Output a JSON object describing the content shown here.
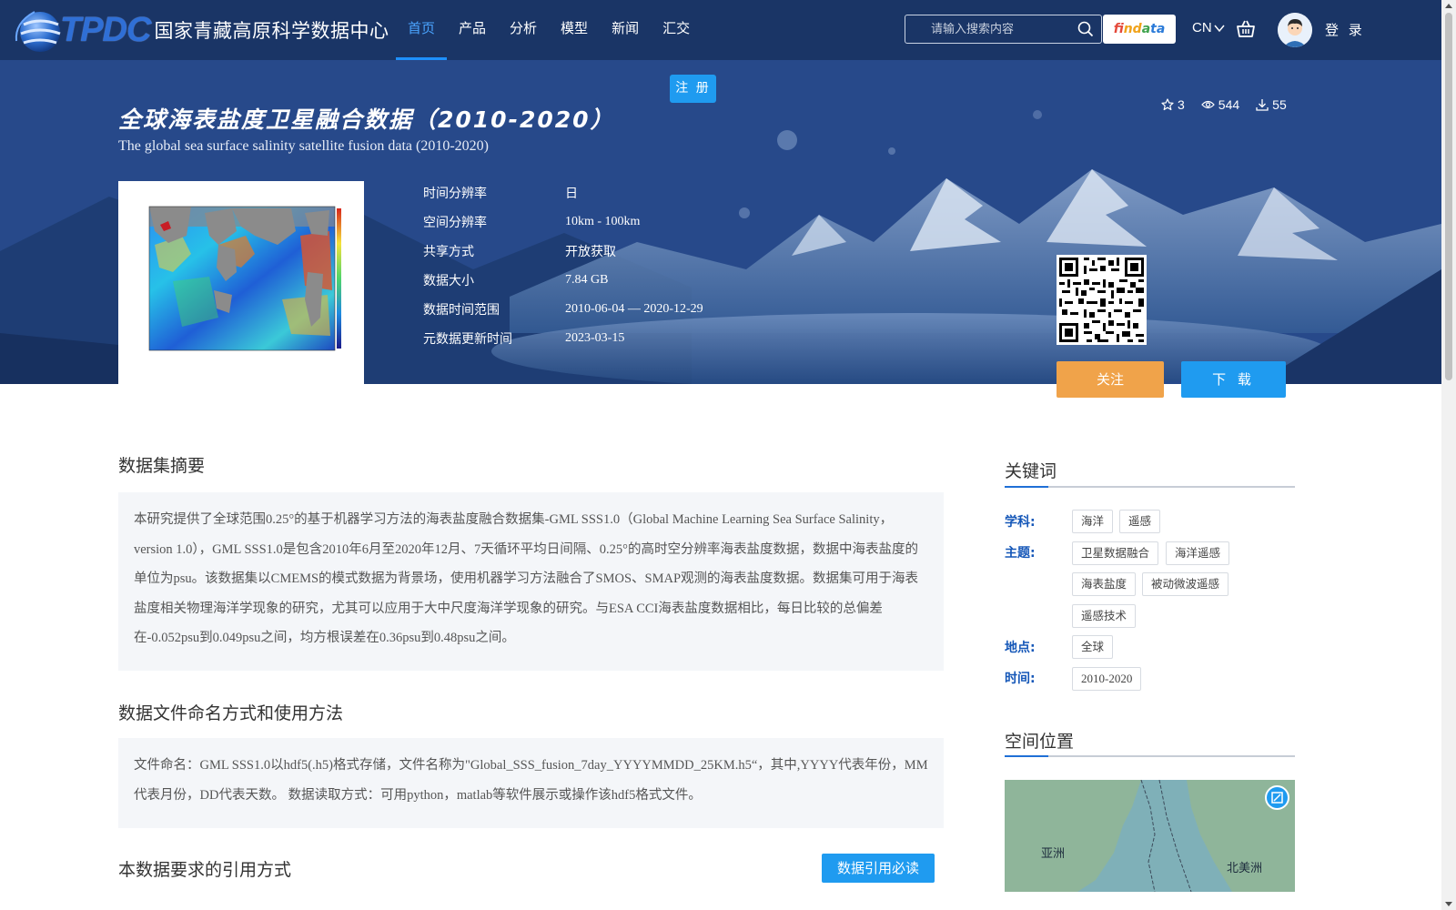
{
  "header": {
    "logo_latin": "TPDC",
    "logo_cn": "国家青藏高原科学数据中心",
    "nav": [
      {
        "label": "首页",
        "active": true
      },
      {
        "label": "产品",
        "active": false
      },
      {
        "label": "分析",
        "active": false
      },
      {
        "label": "模型",
        "active": false
      },
      {
        "label": "新闻",
        "active": false
      },
      {
        "label": "汇交",
        "active": false
      }
    ],
    "search_placeholder": "请输入搜索内容",
    "findata": {
      "p1": "fi",
      "p2": "nd",
      "p3": "a",
      "p4": "ta"
    },
    "lang": "CN",
    "login": "登 录"
  },
  "hero": {
    "register": "注 册",
    "title_cn": "全球海表盐度卫星融合数据（2010-2020）",
    "title_en": "The global sea surface salinity satellite fusion data (2010-2020)",
    "stats": {
      "stars": "3",
      "views": "544",
      "downloads": "55"
    },
    "meta": [
      {
        "label": "时间分辨率",
        "value": "日",
        "cn": true
      },
      {
        "label": "空间分辨率",
        "value": "10km - 100km",
        "cn": false
      },
      {
        "label": "共享方式",
        "value": "开放获取",
        "cn": true
      },
      {
        "label": "数据大小",
        "value": "7.84 GB",
        "cn": false
      },
      {
        "label": "数据时间范围",
        "value": "2010-06-04 — 2020-12-29",
        "cn": false
      },
      {
        "label": "元数据更新时间",
        "value": "2023-03-15",
        "cn": false
      }
    ],
    "follow": "关注",
    "download": "下 载"
  },
  "main": {
    "abstract_title": "数据集摘要",
    "abstract": "本研究提供了全球范围0.25°的基于机器学习方法的海表盐度融合数据集-GML SSS1.0（Global Machine Learning Sea Surface Salinity，version 1.0），GML SSS1.0是包含2010年6月至2020年12月、7天循环平均日间隔、0.25°的高时空分辨率海表盐度数据，数据中海表盐度的单位为psu。该数据集以CMEMS的模式数据为背景场，使用机器学习方法融合了SMOS、SMAP观测的海表盐度数据。数据集可用于海表盐度相关物理海洋学现象的研究，尤其可以应用于大中尺度海洋学现象的研究。与ESA CCI海表盐度数据相比，每日比较的总偏差在-0.052psu到0.049psu之间，均方根误差在0.36psu到0.48psu之间。",
    "naming_title": "数据文件命名方式和使用方法",
    "naming": "文件命名：GML SSS1.0以hdf5(.h5)格式存储，文件名称为\"Global_SSS_fusion_7day_YYYYMMDD_25KM.h5“，其中,YYYY代表年份，MM代表月份，DD代表天数。 数据读取方式：可用python，matlab等软件展示或操作该hdf5格式文件。",
    "citation_title": "本数据要求的引用方式",
    "citation_button": "数据引用必读"
  },
  "sidebar": {
    "keywords_title": "关键词",
    "subject_label": "学科:",
    "subject_tags": [
      "海洋",
      "遥感"
    ],
    "theme_label": "主题:",
    "theme_tags": [
      "卫星数据融合",
      "海洋遥感",
      "海表盐度",
      "被动微波遥感",
      "遥感技术"
    ],
    "place_label": "地点:",
    "place_tags": [
      "全球"
    ],
    "time_label": "时间:",
    "time_tags": [
      "2010-2020"
    ],
    "spatial_title": "空间位置",
    "map_labels": {
      "asia": "亚洲",
      "north_america": "北美洲"
    }
  },
  "colors": {
    "header_bg": "#1a3566",
    "accent_blue": "#1f9bf0",
    "follow_orange": "#f0a34a",
    "keyword_label": "#1557b8"
  }
}
